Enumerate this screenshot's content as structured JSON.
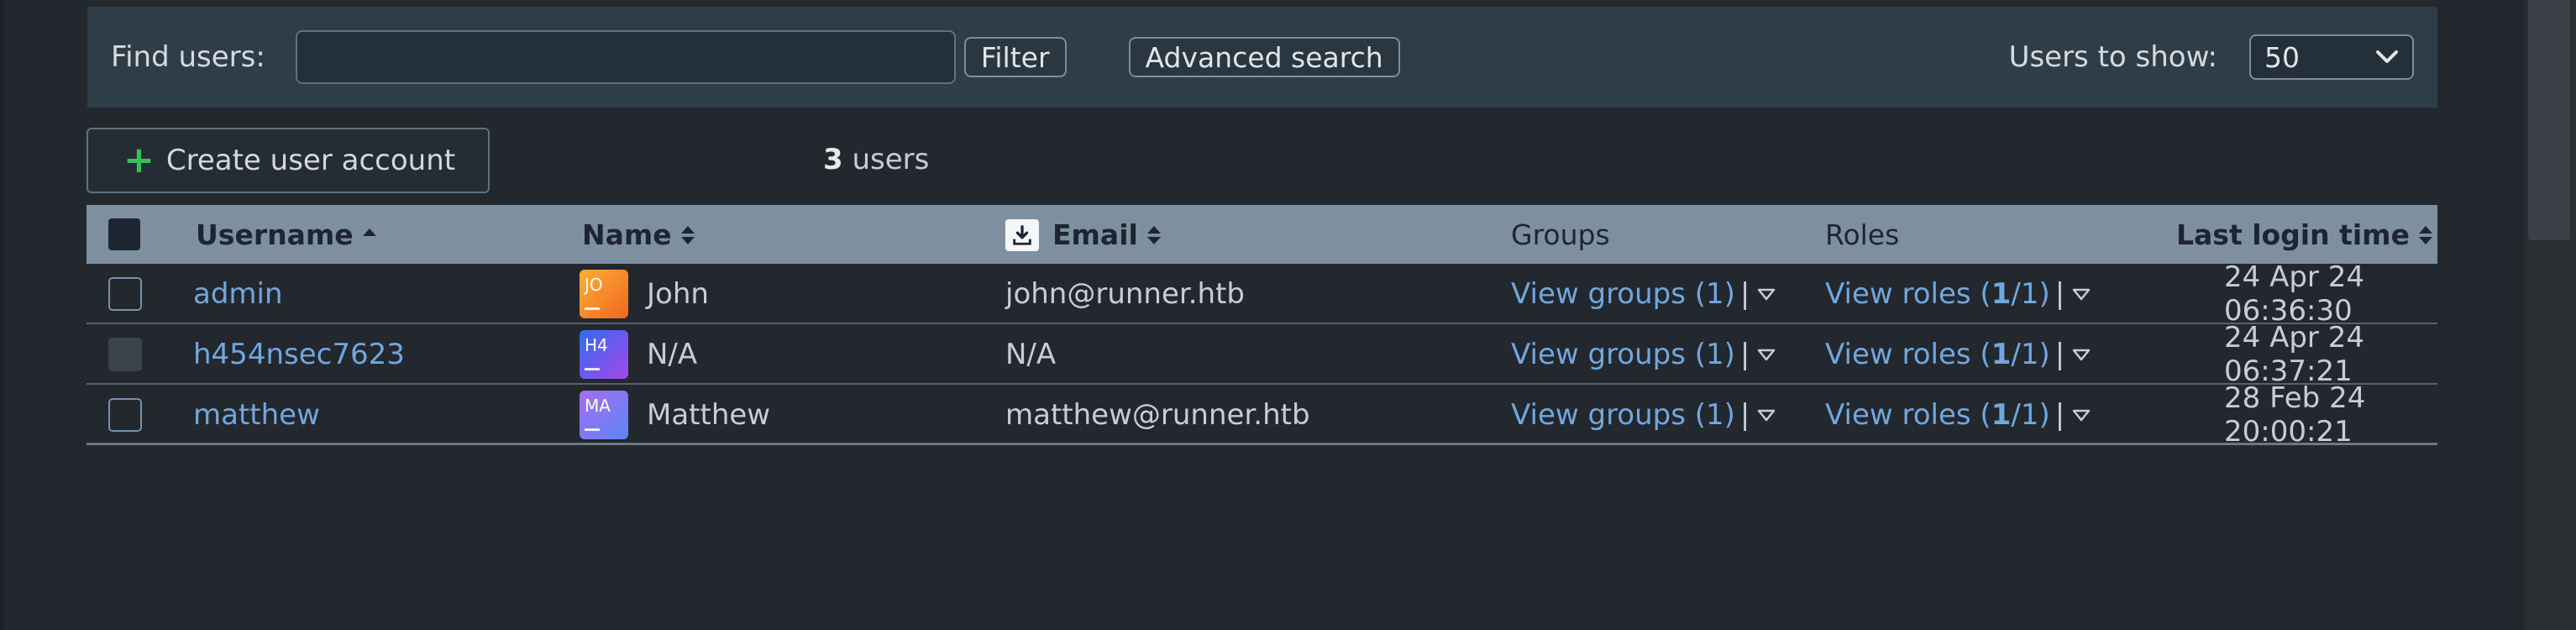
{
  "search": {
    "find_label": "Find users:",
    "input_value": "",
    "filter_label": "Filter",
    "advanced_label": "Advanced search",
    "show_label": "Users to show:",
    "show_value": "50"
  },
  "toolbar": {
    "create_label": "Create user account",
    "count_number": "3",
    "count_suffix": " users"
  },
  "table": {
    "columns": {
      "username": "Username",
      "name": "Name",
      "email": "Email",
      "groups": "Groups",
      "roles": "Roles",
      "last_login": "Last login time"
    },
    "rows": [
      {
        "username": "admin",
        "avatar": "JO",
        "name": "John",
        "email": "john@runner.htb",
        "groups": "View groups (1)",
        "roles_prefix": "View roles (",
        "roles_bold": "1",
        "roles_suffix": "/1)",
        "last_login": "24 Apr 24 06:36:30"
      },
      {
        "username": "h454nsec7623",
        "avatar": "H4",
        "name": "N/A",
        "email": "N/A",
        "groups": "View groups (1)",
        "roles_prefix": "View roles (",
        "roles_bold": "1",
        "roles_suffix": "/1)",
        "last_login": "24 Apr 24 06:37:21"
      },
      {
        "username": "matthew",
        "avatar": "MA",
        "name": "Matthew",
        "email": "matthew@runner.htb",
        "groups": "View groups (1)",
        "roles_prefix": "View roles (",
        "roles_bold": "1",
        "roles_suffix": "/1)",
        "last_login": "28 Feb 24 20:00:21"
      }
    ],
    "pipe": "|"
  },
  "colors": {
    "background": "#23272e",
    "search_panel": "#2f3d49",
    "table_header": "#7e909f",
    "link": "#71a7dc",
    "accent_green": "#36c25a"
  }
}
